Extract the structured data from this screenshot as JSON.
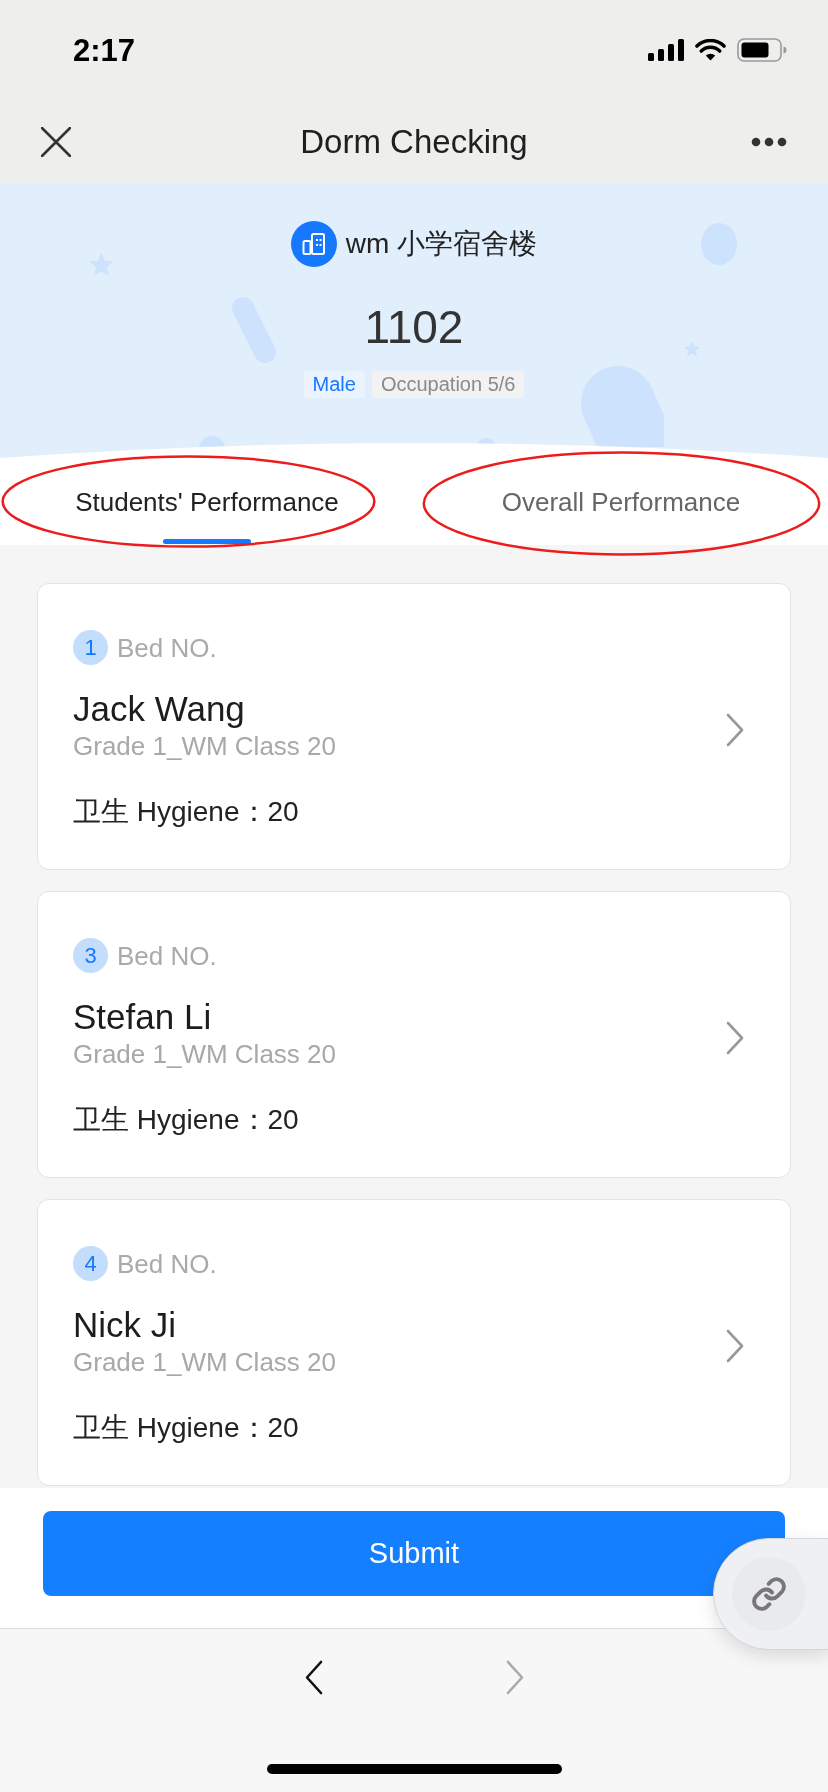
{
  "status_bar": {
    "time": "2:17"
  },
  "nav_bar": {
    "title": "Dorm Checking"
  },
  "header": {
    "building": "wm 小学宿舍楼",
    "room": "1102",
    "tags": [
      {
        "label": "Male",
        "kind": "gender"
      },
      {
        "label": "Occupation 5/6",
        "kind": "info"
      }
    ]
  },
  "tabs": [
    {
      "label": "Students' Performance",
      "selected": true,
      "circled": true
    },
    {
      "label": "Overall Performance",
      "selected": false,
      "circled": true
    }
  ],
  "students": [
    {
      "bed": "1",
      "bed_label": "Bed NO.",
      "name": "Jack Wang",
      "class": "Grade 1_WM Class 20",
      "score": "卫生 Hygiene：20"
    },
    {
      "bed": "3",
      "bed_label": "Bed NO.",
      "name": "Stefan Li",
      "class": "Grade 1_WM Class 20",
      "score": "卫生 Hygiene：20"
    },
    {
      "bed": "4",
      "bed_label": "Bed NO.",
      "name": "Nick Ji",
      "class": "Grade 1_WM Class 20",
      "score": "卫生 Hygiene：20"
    }
  ],
  "submit_button": "Submit",
  "browser_nav": [
    {
      "kind": "back",
      "disabled": false
    },
    {
      "kind": "forward",
      "disabled": true
    }
  ]
}
